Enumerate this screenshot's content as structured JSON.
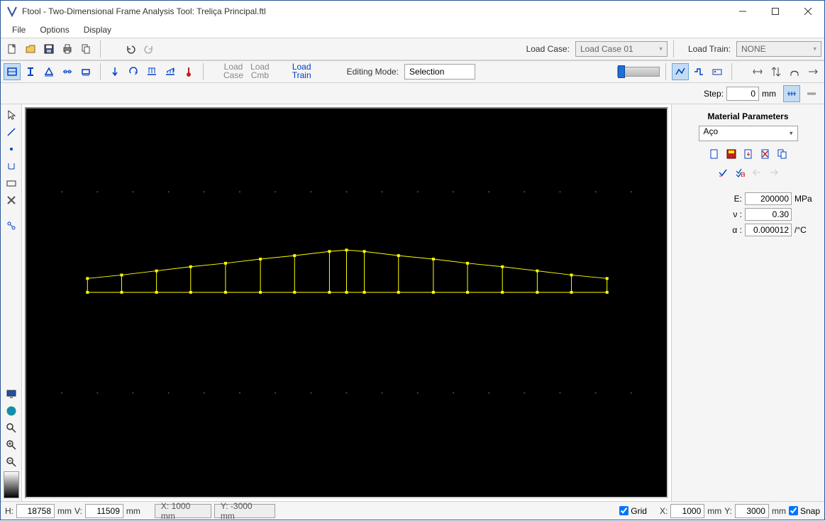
{
  "title": "Ftool - Two-Dimensional Frame Analysis Tool: Treliça Principal.ftl",
  "menu": {
    "file": "File",
    "options": "Options",
    "display": "Display"
  },
  "toolbar1": {
    "loadcase_label": "Load Case:",
    "loadcase_value": "Load Case 01",
    "loadtrain_label": "Load Train:",
    "loadtrain_value": "NONE"
  },
  "toolbar2": {
    "loadcase_btn": "Load\nCase",
    "loadcmb_btn": "Load\nCmb",
    "loadtrain_btn": "Load\nTrain",
    "editmode_label": "Editing Mode:",
    "editmode_value": "Selection"
  },
  "step": {
    "label": "Step:",
    "value": "0",
    "unit": "mm"
  },
  "right_panel": {
    "title": "Material Parameters",
    "material": "Aço",
    "params": {
      "E": {
        "label": "E:",
        "value": "200000",
        "unit": "MPa"
      },
      "nu": {
        "label": "ν :",
        "value": "0.30",
        "unit": ""
      },
      "alpha": {
        "label": "α :",
        "value": "0.000012",
        "unit": "/°C"
      }
    }
  },
  "status": {
    "H_label": "H:",
    "H_value": "18758",
    "H_unit": "mm",
    "V_label": "V:",
    "V_value": "11509",
    "V_unit": "mm",
    "X_box": "X: 1000 mm",
    "Y_box": "Y: -3000 mm",
    "grid_label": "Grid",
    "gridX_label": "X:",
    "gridX_value": "1000",
    "gridX_unit": "mm",
    "gridY_label": "Y:",
    "gridY_value": "3000",
    "gridY_unit": "mm",
    "snap_label": "Snap"
  }
}
